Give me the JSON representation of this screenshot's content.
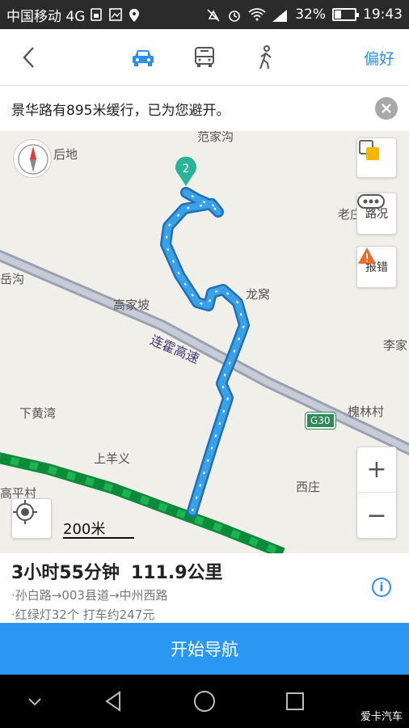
{
  "status_bar": {
    "carrier": "中国移动 4G",
    "network": "4G",
    "battery": "32%",
    "battery_level": 0.32,
    "time": "19:43"
  },
  "top_bar": {
    "preference_label": "偏好",
    "selected_mode": "car",
    "modes": [
      "car",
      "bus",
      "walk"
    ]
  },
  "notice": {
    "text": "景华路有895米缓行，已为您避开。"
  },
  "map": {
    "places": {
      "fanjiagou": "范家沟",
      "houdi": "后地",
      "laozhuang": "老庄",
      "yuegou": "岳沟",
      "gaojiapo": "高家坡",
      "longwo": "龙窝",
      "lijia": "李家",
      "xiahuangwan": "下黄湾",
      "huailincun": "槐林村",
      "shangyangyi": "上羊义",
      "xizhuang": "西庄",
      "gaopingcun": "高平村"
    },
    "highway_name": "连霍高速",
    "highway_shield": "G30",
    "waypoint_label": "2",
    "traffic_label": "路况",
    "report_label": "报错",
    "scale_label": "200米",
    "compass_label": "北",
    "zoom_in": "+",
    "zoom_out": "−",
    "route_color": "#3aa0e8",
    "highway_route_color": "#1fb255"
  },
  "route_info": {
    "duration": "3小时55分钟",
    "distance": "111.9公里",
    "roads": "·孙白路→003县道→中州西路",
    "details": "·红绿灯32个  打车约247元"
  },
  "start_button": "开始导航",
  "watermark": "爱卡汽车"
}
